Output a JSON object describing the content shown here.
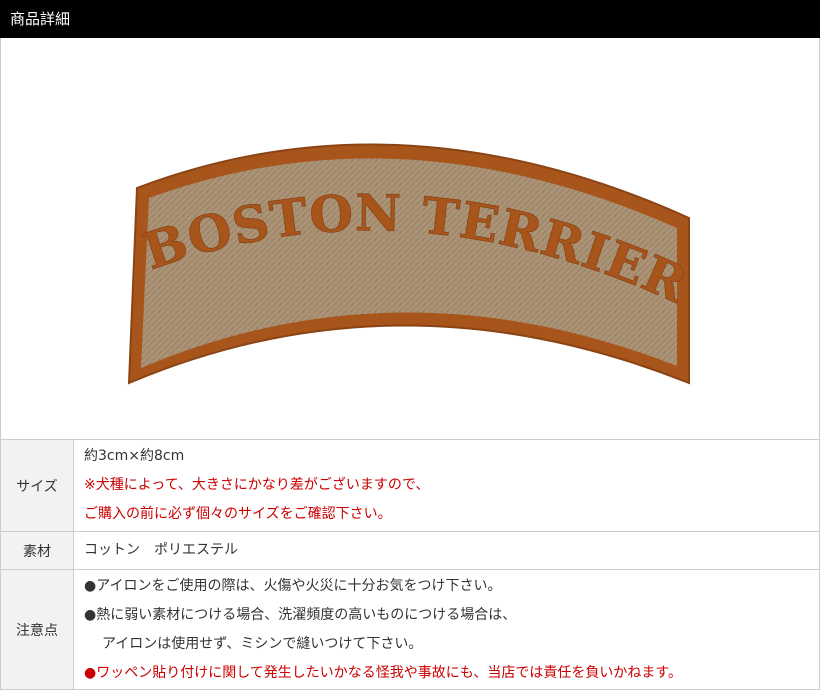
{
  "header": {
    "title": "商品詳細"
  },
  "product": {
    "patch_text": "BOSTON TERRIER"
  },
  "colors": {
    "patch_border": "#a8551c",
    "patch_fill": "#a88e72",
    "patch_text": "#a8551c",
    "header_bg": "#000000",
    "warning": "#cc0000"
  },
  "rows": {
    "size": {
      "label": "サイズ",
      "value": "約3cm×約8cm",
      "note1": "※犬種によって、大きさにかなり差がございますので、",
      "note2": "ご購入の前に必ず個々のサイズをご確認下さい。"
    },
    "material": {
      "label": "素材",
      "value": "コットン　ポリエステル"
    },
    "caution": {
      "label": "注意点",
      "bullet": "●",
      "line1": "アイロンをご使用の際は、火傷や火災に十分お気をつけ下さい。",
      "line2": "熱に弱い素材につける場合、洗濯頻度の高いものにつける場合は、",
      "line3": "アイロンは使用せず、ミシンで縫いつけて下さい。",
      "line4": "ワッペン貼り付けに関して発生したいかなる怪我や事故にも、当店では責任を負いかねます。"
    }
  }
}
